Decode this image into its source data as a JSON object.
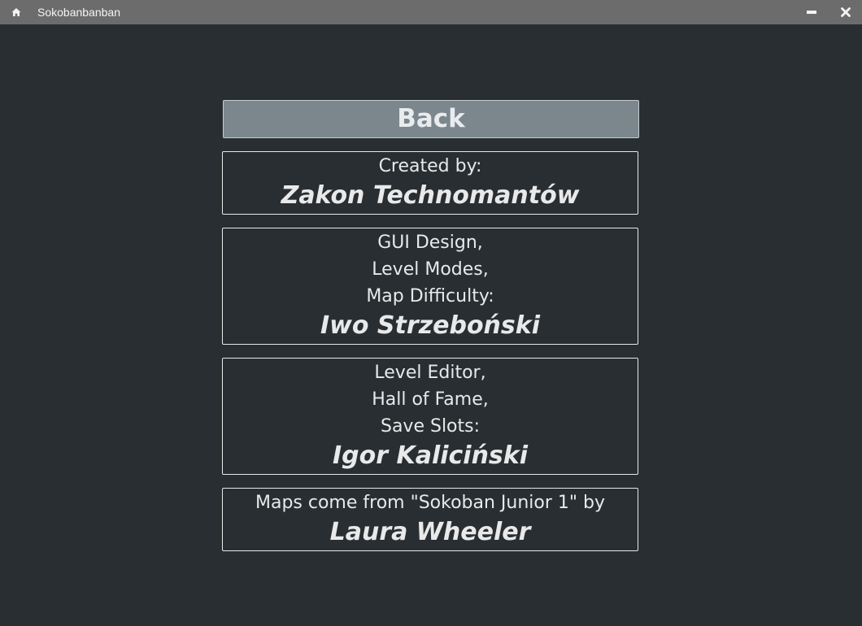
{
  "window": {
    "title": "Sokobanbanban",
    "home_icon": "home-icon",
    "minimize_icon": "minimize-icon",
    "close_icon": "close-icon"
  },
  "back_button": {
    "label": "Back"
  },
  "credits": [
    {
      "roles": [
        "Created by:"
      ],
      "name": "Zakon Technomantów"
    },
    {
      "roles": [
        "GUI Design,",
        "Level Modes,",
        "Map Difficulty:"
      ],
      "name": "Iwo Strzeboński"
    },
    {
      "roles": [
        "Level Editor,",
        "Hall of Fame,",
        "Save Slots:"
      ],
      "name": "Igor Kaliciński"
    },
    {
      "roles": [
        "Maps come from \"Sokoban Junior 1\" by"
      ],
      "name": "Laura Wheeler"
    }
  ],
  "colors": {
    "background": "#282e32",
    "titlebar": "#6c6c6c",
    "button": "#7b878d",
    "text": "#e9e9e9"
  }
}
